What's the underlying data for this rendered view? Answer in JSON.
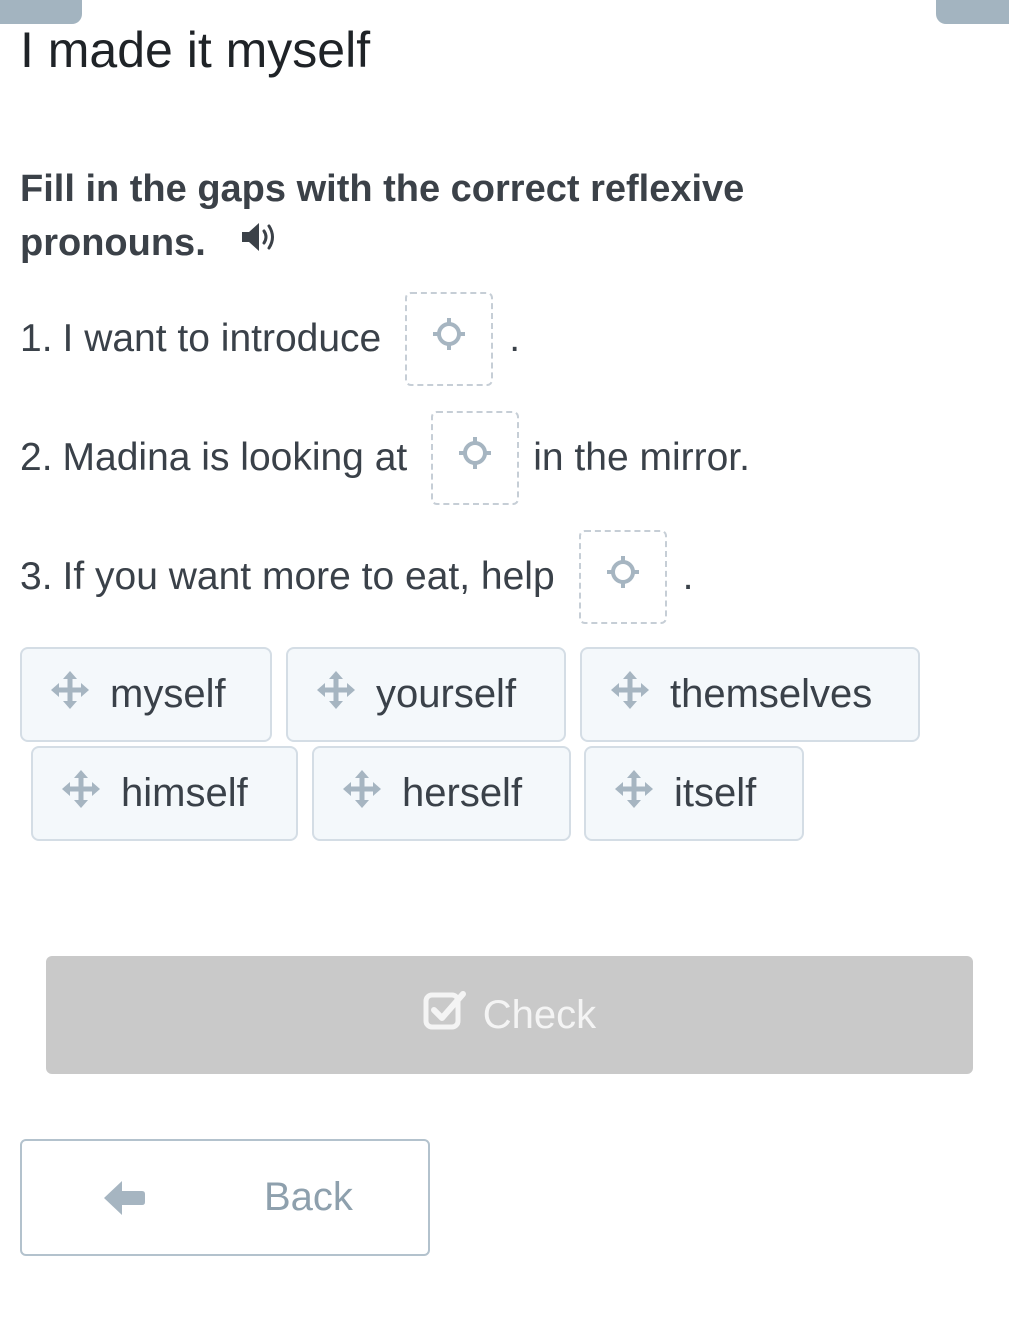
{
  "page": {
    "title": "I made it myself",
    "instructions": "Fill in the gaps with the correct reflexive pronouns."
  },
  "icons": {
    "audio": "speaker-icon",
    "gap": "crosshair-target-icon",
    "chip": "move-arrows-icon",
    "check": "checkbox-check-icon",
    "back": "arrow-left-icon"
  },
  "questions": [
    {
      "number": "1.",
      "before": "I want to introduce",
      "after": "."
    },
    {
      "number": "2.",
      "before": "Madina is looking at",
      "after": "in the mirror."
    },
    {
      "number": "3.",
      "before": "If you want more to eat, help",
      "after": "."
    }
  ],
  "word_bank": [
    "myself",
    "yourself",
    "themselves",
    "himself",
    "herself",
    "itself"
  ],
  "buttons": {
    "check": "Check",
    "back": "Back"
  },
  "colors": {
    "accent": "#a3b4c0",
    "chip_background": "#f4f8fb",
    "check_button_disabled": "#c9c9c9",
    "back_text": "#8ea0ad"
  }
}
